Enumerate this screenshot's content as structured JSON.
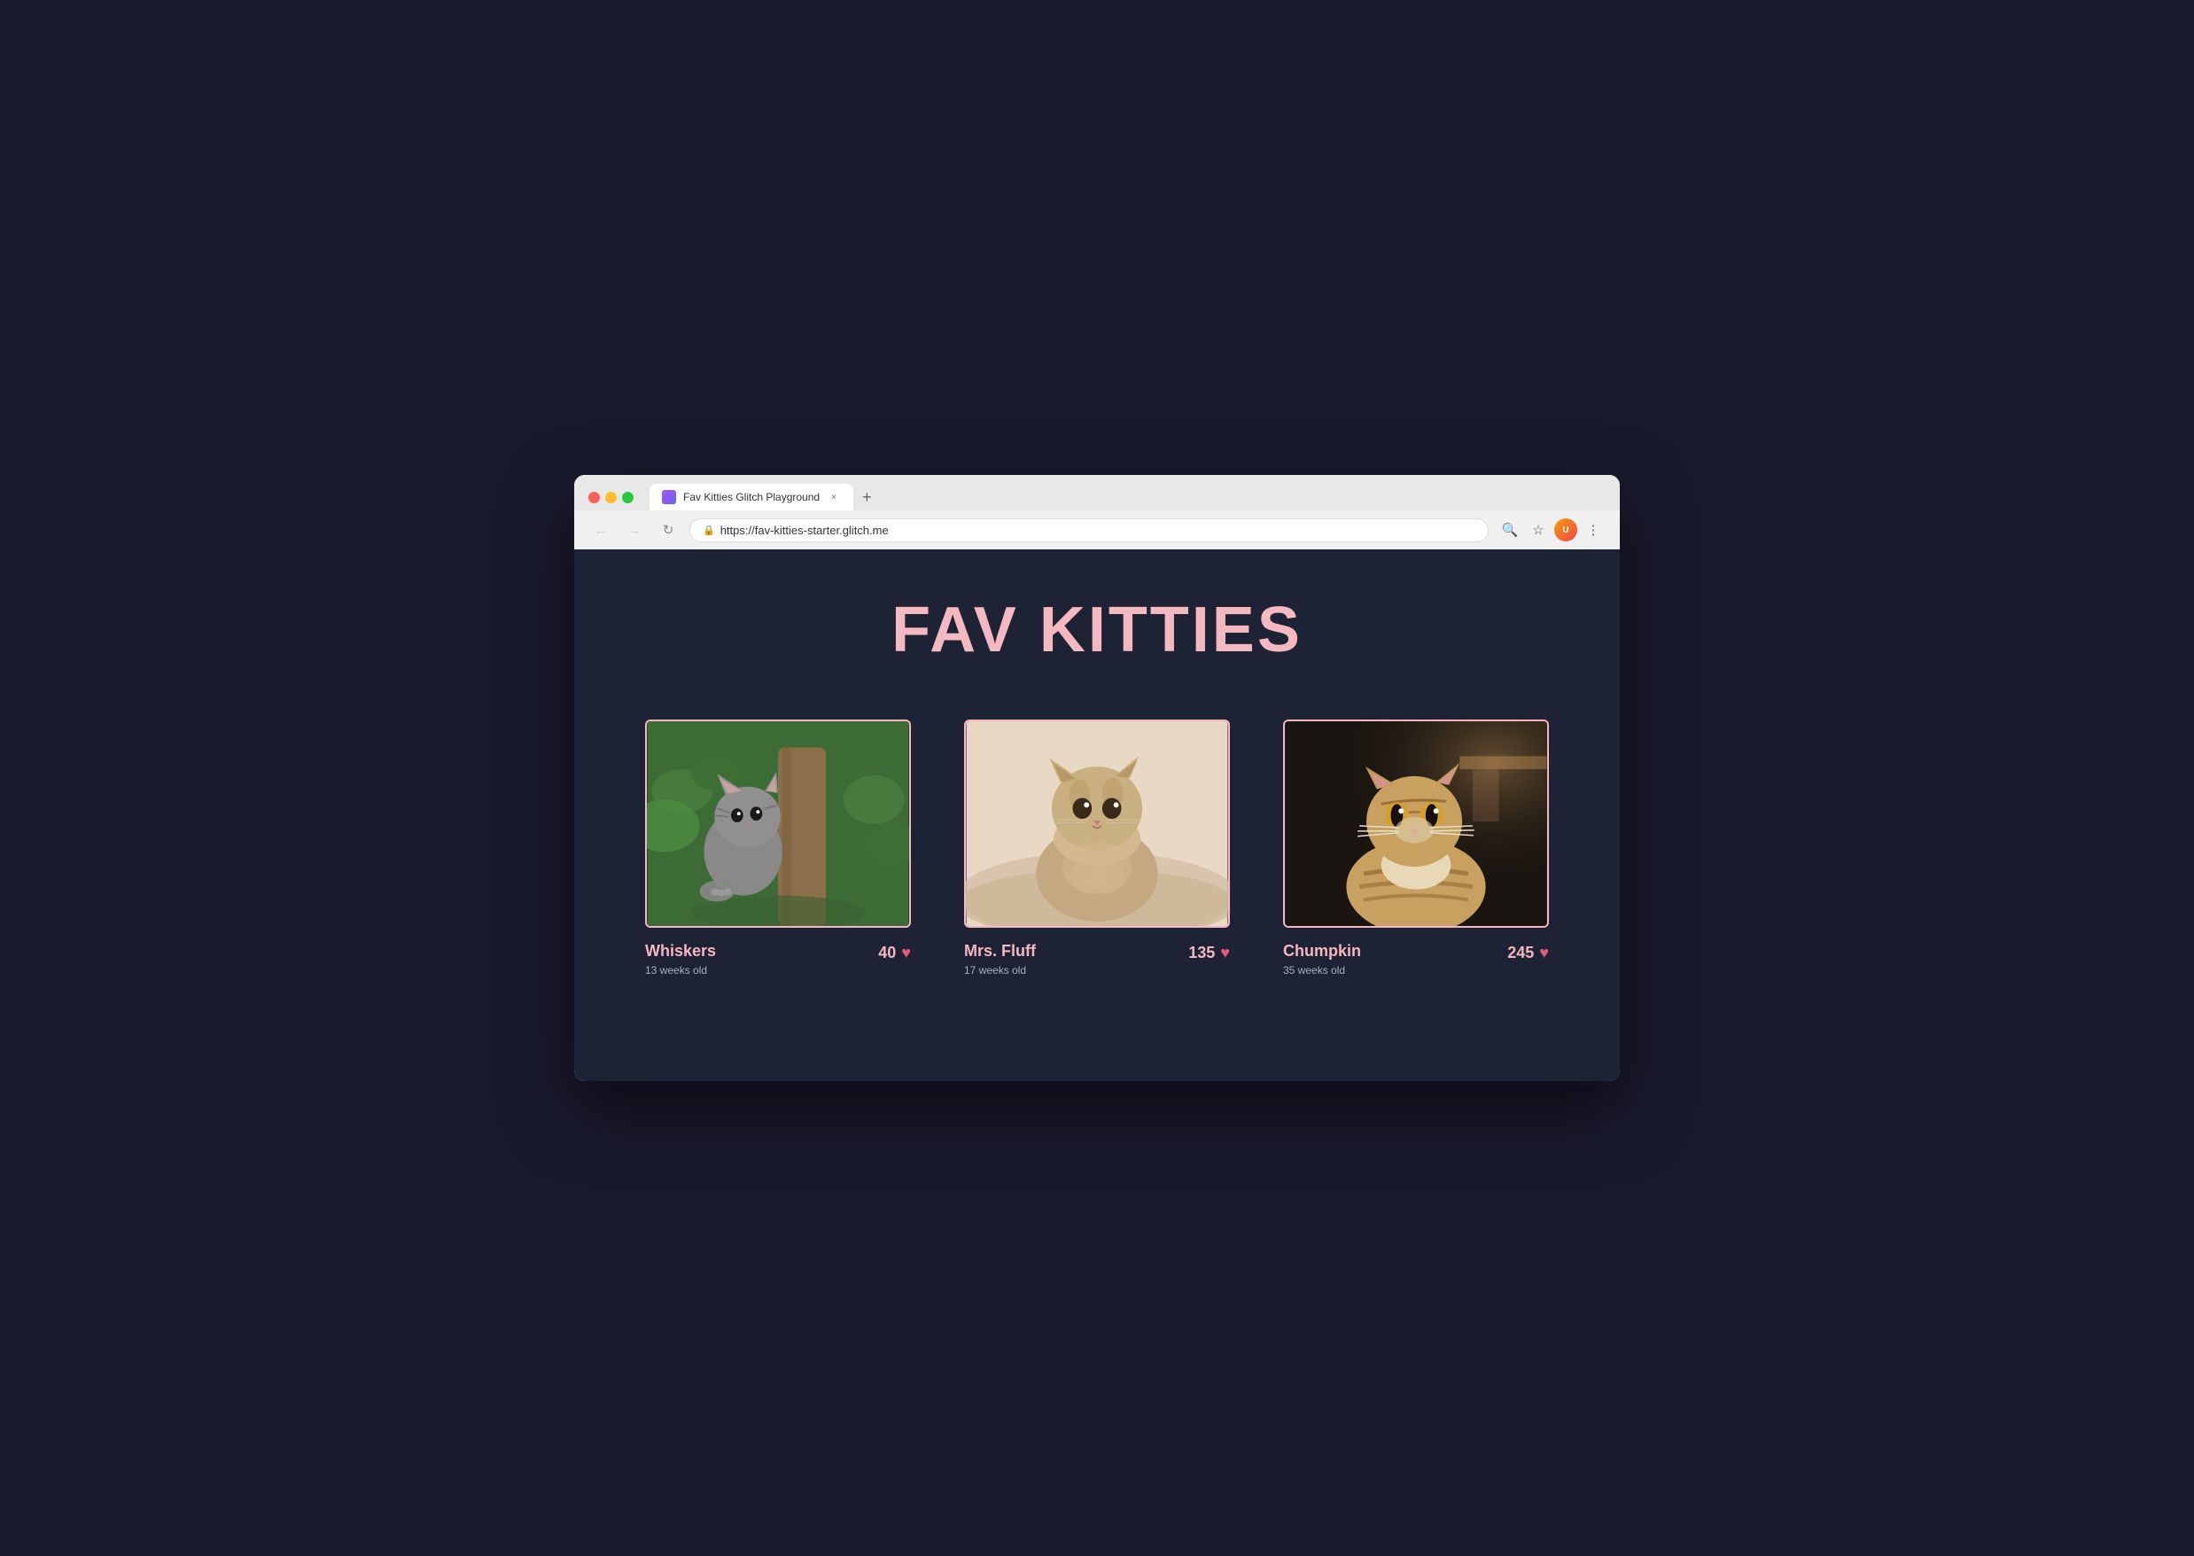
{
  "browser": {
    "tab_title": "Fav Kitties Glitch Playground",
    "tab_close_label": "×",
    "tab_new_label": "+",
    "url": "https://fav-kitties-starter.glitch.me",
    "nav_back": "←",
    "nav_forward": "→",
    "nav_reload": "↻",
    "toolbar_search": "🔍",
    "toolbar_star": "☆",
    "toolbar_menu": "⋮"
  },
  "page": {
    "title": "FAV KITTIES",
    "background_color": "#1e2235",
    "accent_color": "#f4b8c0"
  },
  "cats": [
    {
      "name": "Whiskers",
      "age": "13 weeks old",
      "votes": "40",
      "image_description": "gray kitten outdoors in greenery"
    },
    {
      "name": "Mrs. Fluff",
      "age": "17 weeks old",
      "votes": "135",
      "image_description": "fluffy kitten in sepia tones"
    },
    {
      "name": "Chumpkin",
      "age": "35 weeks old",
      "votes": "245",
      "image_description": "tabby cat looking up"
    }
  ]
}
